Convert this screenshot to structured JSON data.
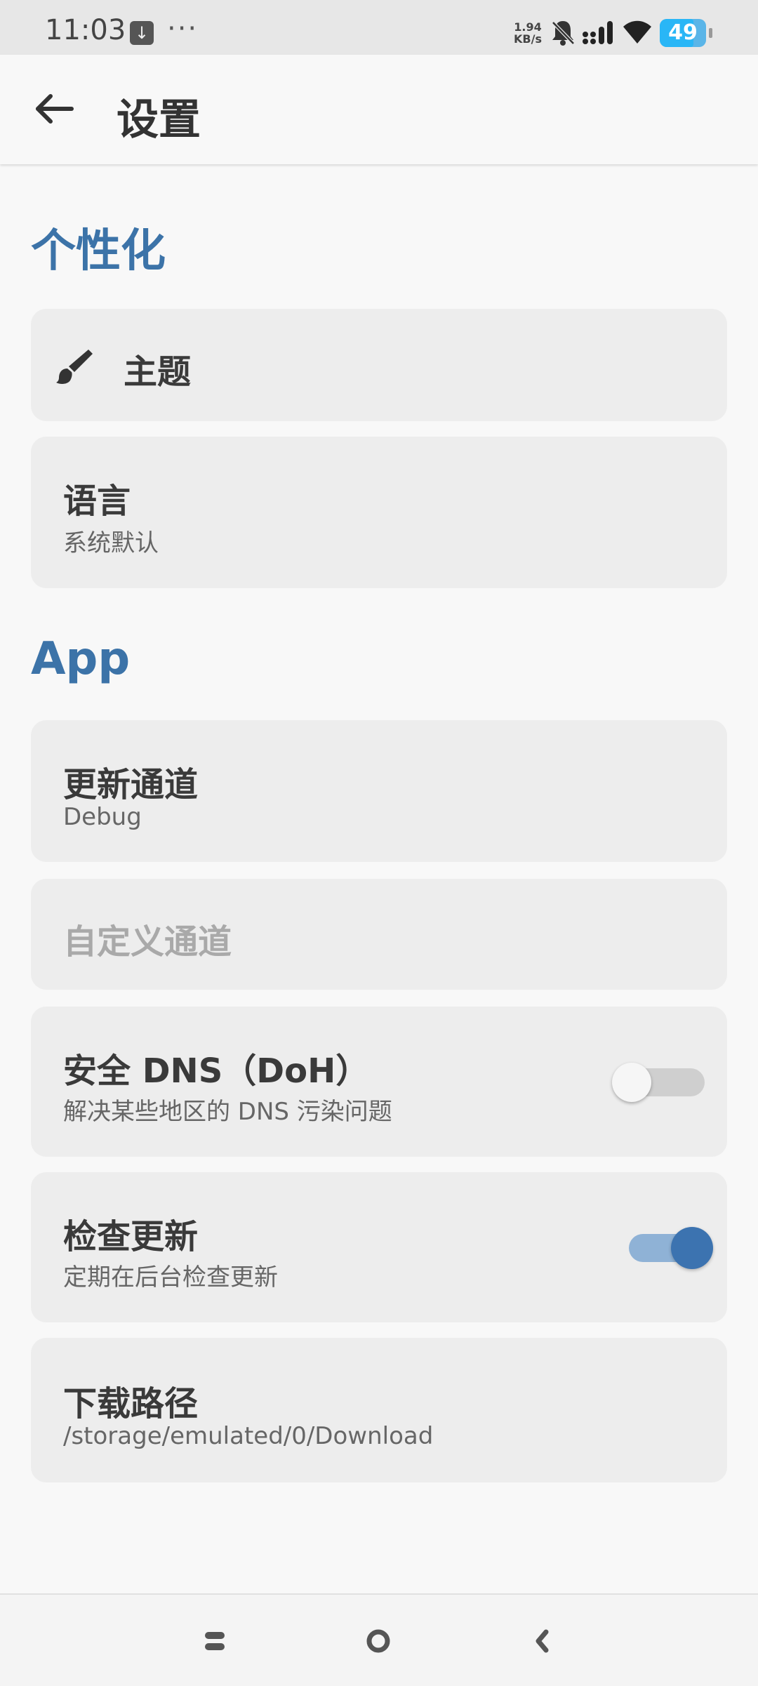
{
  "status_bar": {
    "time": "11:03",
    "download_icon": "download-arrow-icon",
    "more": "···",
    "speed_value": "1.94",
    "speed_unit": "KB/s",
    "battery": "49",
    "icons": [
      "bell-off-icon",
      "signal-icon",
      "wifi-icon",
      "battery-icon"
    ]
  },
  "app_bar": {
    "back_icon": "arrow-left-icon",
    "title": "设置"
  },
  "sections": {
    "personalization": {
      "title": "个性化",
      "theme": {
        "icon": "brush-icon",
        "label": "主题"
      },
      "language": {
        "title": "语言",
        "value": "系统默认"
      }
    },
    "app": {
      "title": "App",
      "update_channel": {
        "title": "更新通道",
        "value": "Debug"
      },
      "custom_channel": {
        "title": "自定义通道"
      },
      "secure_dns": {
        "title": "安全 DNS（DoH）",
        "subtitle": "解决某些地区的 DNS 污染问题",
        "enabled": false
      },
      "check_update": {
        "title": "检查更新",
        "subtitle": "定期在后台检查更新",
        "enabled": true
      },
      "download_path": {
        "title": "下载路径",
        "value": "/storage/emulated/0/Download"
      }
    }
  },
  "colors": {
    "accent": "#3c73a8",
    "card": "#ededed",
    "background": "#f8f8f8"
  },
  "nav_bar": {
    "icons": [
      "recents-icon",
      "home-icon",
      "back-nav-icon"
    ]
  }
}
